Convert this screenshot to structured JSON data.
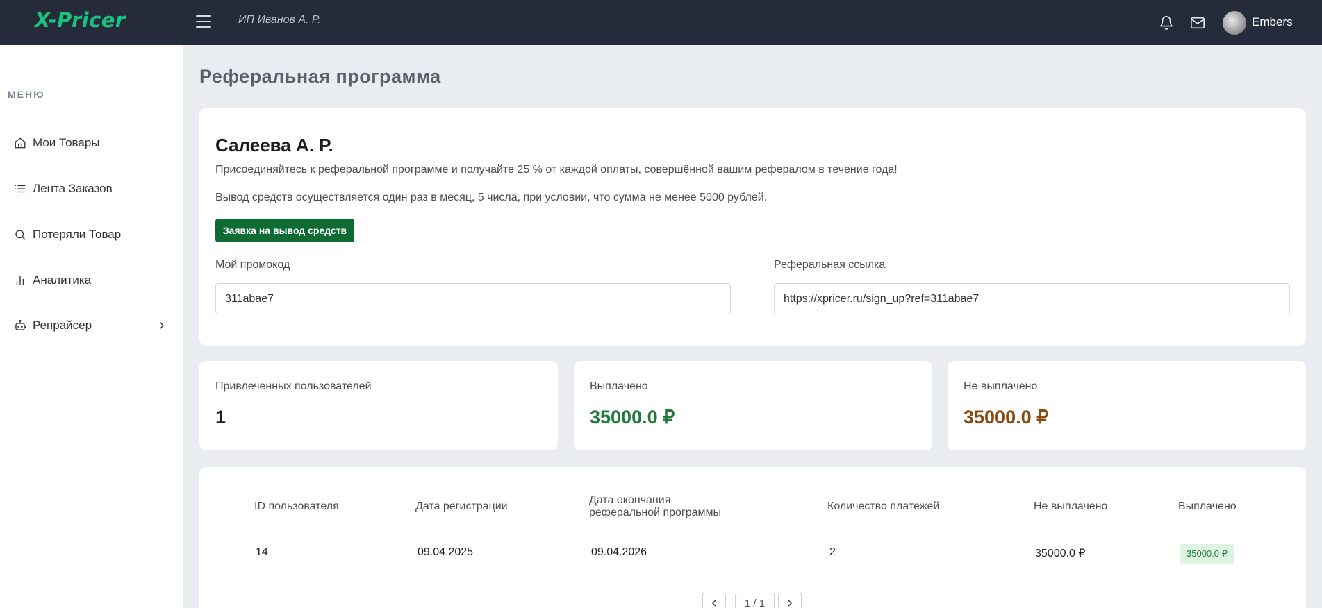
{
  "header": {
    "logo": "X-Pricer",
    "company": "ИП Иванов А. Р.",
    "username": "Embers"
  },
  "sidebar": {
    "menu_label": "МЕНЮ",
    "items": [
      {
        "label": "Мои Товары",
        "icon": "home-icon"
      },
      {
        "label": "Лента Заказов",
        "icon": "list-icon"
      },
      {
        "label": "Потеряли Товар",
        "icon": "search-icon"
      },
      {
        "label": "Аналитика",
        "icon": "bar-chart-icon"
      },
      {
        "label": "Репрайсер",
        "icon": "robot-icon"
      }
    ]
  },
  "main": {
    "page_title": "Реферальная программа",
    "referral_card": {
      "name": "Салеева А. Р.",
      "text1": "Присоединяйтесь к реферальной программе и получайте 25 % от каждой оплаты, совершённой вашим рефералом в течение года!",
      "text2": "Вывод средств осуществляется один раз в месяц, 5 числа, при условии, что сумма не менее 5000 рублей.",
      "withdraw_button": "Заявка на вывод средств",
      "promo_label": "Мой промокод",
      "promo_value": "311abae7",
      "link_label": "Реферальная ссылка",
      "link_value": "https://xpricer.ru/sign_up?ref=311abae7"
    },
    "stats": {
      "invited_label": "Привлеченных пользователей",
      "invited_value": "1",
      "paid_label": "Выплачено",
      "paid_value": "35000.0 ₽",
      "unpaid_label": "Не выплачено",
      "unpaid_value": "35000.0 ₽"
    },
    "table": {
      "columns": [
        "ID пользователя",
        "Дата регистрации",
        "Дата окончания",
        "реферальной программы",
        "Количество платежей",
        "Не выплачено",
        "Выплачено"
      ],
      "rows": [
        {
          "id": "14",
          "reg_date": "09.04.2025",
          "end_date": "09.04.2026",
          "payments": "2",
          "unpaid": "35000.0 ₽",
          "paid": "35000.0 ₽"
        }
      ],
      "pagination": "1 / 1"
    }
  },
  "colors": {
    "topbar": "#252b3a",
    "logo": "#19c37d",
    "button": "#0d6b33",
    "paid": "#1f7a3a",
    "unpaid": "#8a4a12"
  }
}
